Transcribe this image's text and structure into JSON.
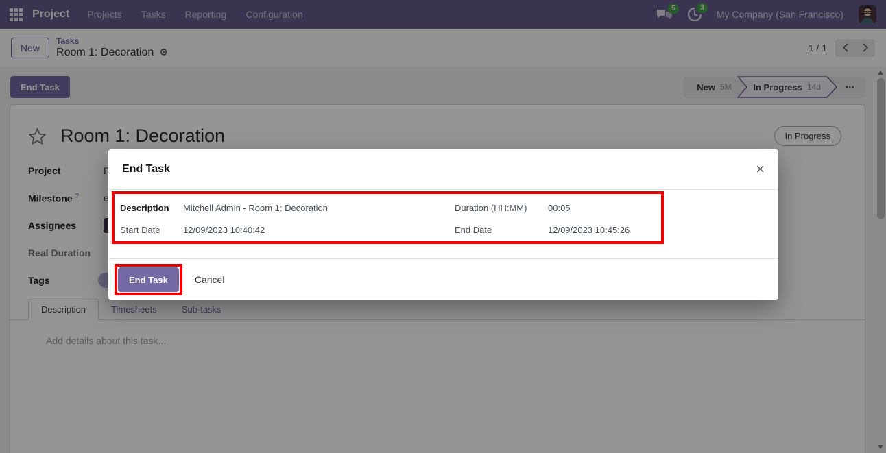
{
  "navbar": {
    "app_name": "Project",
    "menus": [
      "Projects",
      "Tasks",
      "Reporting",
      "Configuration"
    ],
    "messages_badge": "5",
    "activities_badge": "3",
    "company": "My Company (San Francisco)"
  },
  "breadcrumb": {
    "new_button": "New",
    "parent": "Tasks",
    "current": "Room 1: Decoration",
    "pager": "1 / 1"
  },
  "statusbar": {
    "end_task_button": "End Task",
    "stages": [
      {
        "label": "New",
        "duration": "5M",
        "active": false
      },
      {
        "label": "In Progress",
        "duration": "14d",
        "active": true
      }
    ],
    "more": "..."
  },
  "form": {
    "title": "Room 1: Decoration",
    "state_badge": "In Progress",
    "milestone_help": "?",
    "fields": [
      {
        "label": "Project",
        "value_visible": "R"
      },
      {
        "label": "Milestone",
        "value_visible": "e"
      },
      {
        "label": "Assignees",
        "value_visible": ""
      },
      {
        "label": "Real Duration",
        "value_visible": ""
      },
      {
        "label": "Tags",
        "value_visible": ""
      }
    ],
    "tabs": [
      "Description",
      "Timesheets",
      "Sub-tasks"
    ],
    "description_placeholder": "Add details about this task..."
  },
  "modal": {
    "title": "End Task",
    "fields": {
      "description_label": "Description",
      "description_value": "Mitchell Admin - Room 1: Decoration",
      "duration_label": "Duration (HH:MM)",
      "duration_value": "00:05",
      "start_date_label": "Start Date",
      "start_date_value": "12/09/2023 10:40:42",
      "end_date_label": "End Date",
      "end_date_value": "12/09/2023 10:45:26"
    },
    "footer": {
      "confirm": "End Task",
      "cancel": "Cancel"
    }
  },
  "icons": {
    "gear": "⚙",
    "close": "×"
  },
  "colors": {
    "navbar_bg": "#665a8c",
    "primary_button": "#7368a2",
    "highlight_red": "#ee0000",
    "badge_green": "#42a048"
  }
}
